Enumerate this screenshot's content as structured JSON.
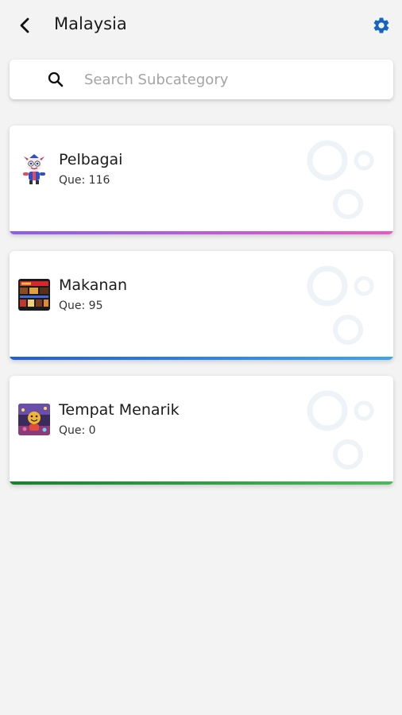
{
  "header": {
    "title": "Malaysia",
    "back_icon": "back-arrow-icon",
    "settings_icon": "gear-icon",
    "accent_color": "#1565c0"
  },
  "search": {
    "placeholder": "Search Subcategory",
    "value": "",
    "icon": "search-icon"
  },
  "subcategories": [
    {
      "name": "Pelbagai",
      "count_label": "Que: 116",
      "thumbnail": "cartoon-mascot-thumbnail",
      "bar_colors": [
        "#8e5cf0",
        "#e85ac4"
      ]
    },
    {
      "name": "Makanan",
      "count_label": "Que: 95",
      "thumbnail": "food-menu-thumbnail",
      "bar_colors": [
        "#1f5fd6",
        "#3aa6ec"
      ]
    },
    {
      "name": "Tempat Menarik",
      "count_label": "Que: 0",
      "thumbnail": "attraction-thumbnail",
      "bar_colors": [
        "#1b7f2c",
        "#4fb85c"
      ]
    }
  ]
}
